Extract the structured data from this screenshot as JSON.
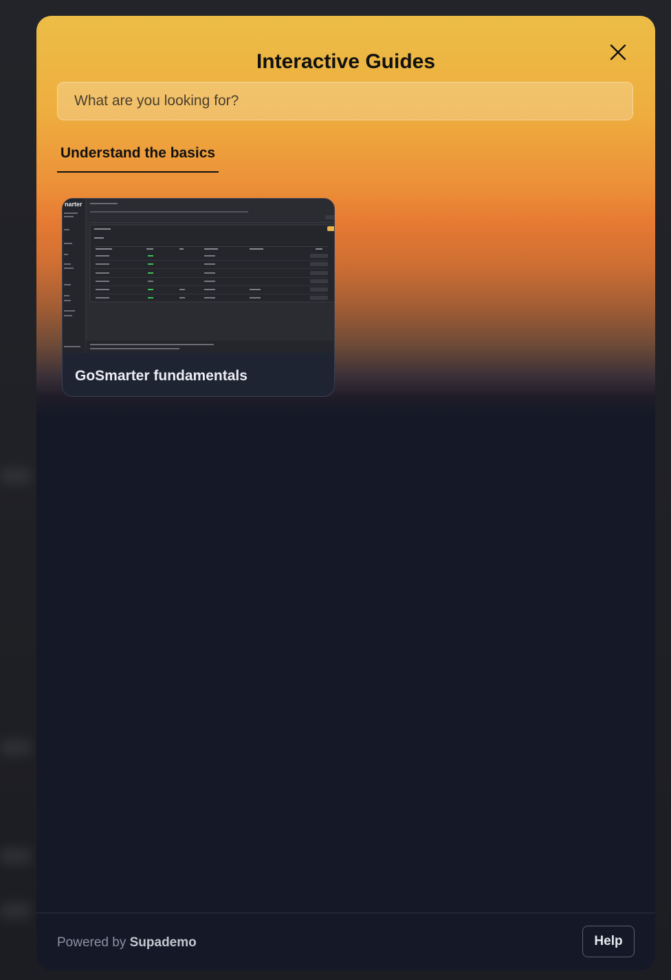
{
  "modal": {
    "title": "Interactive Guides",
    "search_placeholder": "What are you looking for?",
    "tabs": [
      {
        "label": "Understand the basics",
        "active": true
      }
    ],
    "cards": [
      {
        "title": "GoSmarter fundamentals",
        "thumbnail": {
          "logo_text": "narter"
        }
      }
    ]
  },
  "footer": {
    "powered_prefix": "Powered by",
    "powered_brand": "Supademo",
    "help_label": "Help"
  },
  "colors": {
    "gradient_top": "#ecbd46",
    "gradient_mid": "#e67a33",
    "panel_dark": "#151927"
  }
}
